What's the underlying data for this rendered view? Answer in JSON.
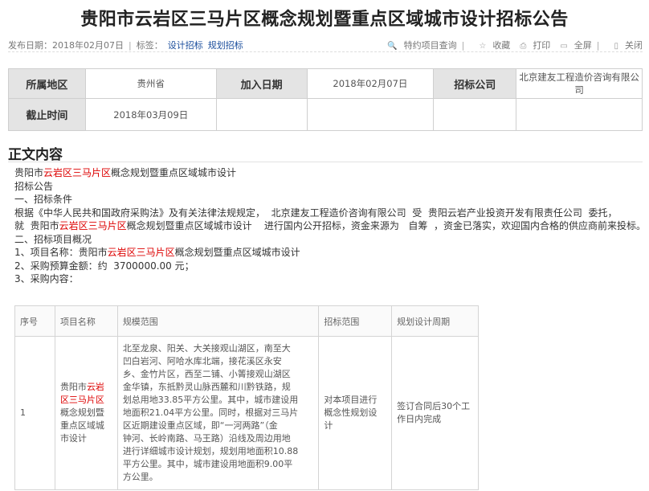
{
  "title": "贵阳市云岩区三马片区概念规划暨重点区域城市设计招标公告",
  "meta": {
    "publish_label": "发布日期：",
    "publish_date": "2018年02月07日",
    "tags_label": "标签：",
    "tags": [
      "设计招标",
      "规划招标"
    ],
    "actions": {
      "special_query": "特约项目查询",
      "favorite": "收藏",
      "print": "打印",
      "fullscreen": "全屏",
      "close": "关闭"
    }
  },
  "info": {
    "region_label": "所属地区",
    "region": "贵州省",
    "added_label": "加入日期",
    "added": "2018年02月07日",
    "agency_label": "招标公司",
    "agency": "北京建友工程造价咨询有限公司",
    "deadline_label": "截止时间",
    "deadline": "2018年03月09日"
  },
  "content": {
    "section_title": "正文内容",
    "l1_pre": "贵阳市",
    "l1_red": "云岩区三马片区",
    "l1_post": "概念规划暨重点区域城市设计",
    "l2": "招标公告",
    "l3": "一、招标条件",
    "l4": "根据《中华人民共和国政府采购法》及有关法律法规规定，  北京建友工程造价咨询有限公司  受  贵阳云岩产业投资开发有限责任公司  委托，",
    "l5_pre": "就  贵阳市",
    "l5_red": "云岩区三马片区",
    "l5_post": "概念规划暨重点区域城市设计    进行国内公开招标，资金来源为   自筹  ，资金已落实，欢迎国内合格的供应商前来投标。",
    "l6": "二、招标项目概况",
    "l7_pre": "1、项目名称：贵阳市",
    "l7_red": "云岩区三马片区",
    "l7_post": "概念规划暨重点区域城市设计",
    "l8": "2、采购预算金额：约  3700000.00 元；",
    "l9": "3、采购内容："
  },
  "items_table": {
    "headers": [
      "序号",
      "项目名称",
      "规模范围",
      "招标范围",
      "规划设计周期"
    ],
    "row": {
      "no": "1",
      "name_l1_pre": "贵阳市",
      "name_l1_red": "云岩",
      "name_l2_red": "区三马片区",
      "name_l3": "概念规划暨",
      "name_l4": "重点区域城",
      "name_l5": "市设计",
      "scope_lines": [
        "北至龙泉、阳关、大关接观山湖区，南至大",
        "凹白岩河、阿哈水库北端，接花溪区永安",
        "乡、金竹片区，西至二铺、小箐接观山湖区",
        "金华镇，东抵黔灵山脉西麓和川黔铁路，规",
        "划总用地33.85平方公里。其中，城市建设用",
        "地面积21.04平方公里。同时，根据对三马片",
        "区近期建设重点区域，即“一河两路”（金",
        "钟河、长岭南路、马王路）沿线及周边用地",
        "进行详细城市设计规划，规划用地面积10.88",
        "平方公里。其中，城市建设用地面积9.00平",
        "方公里。"
      ],
      "range_l1": "对本项目进行",
      "range_l2": "概念性规划设",
      "range_l3": "计",
      "period_l1": "签订合同后30个工",
      "period_l2": "作日内完成"
    }
  }
}
